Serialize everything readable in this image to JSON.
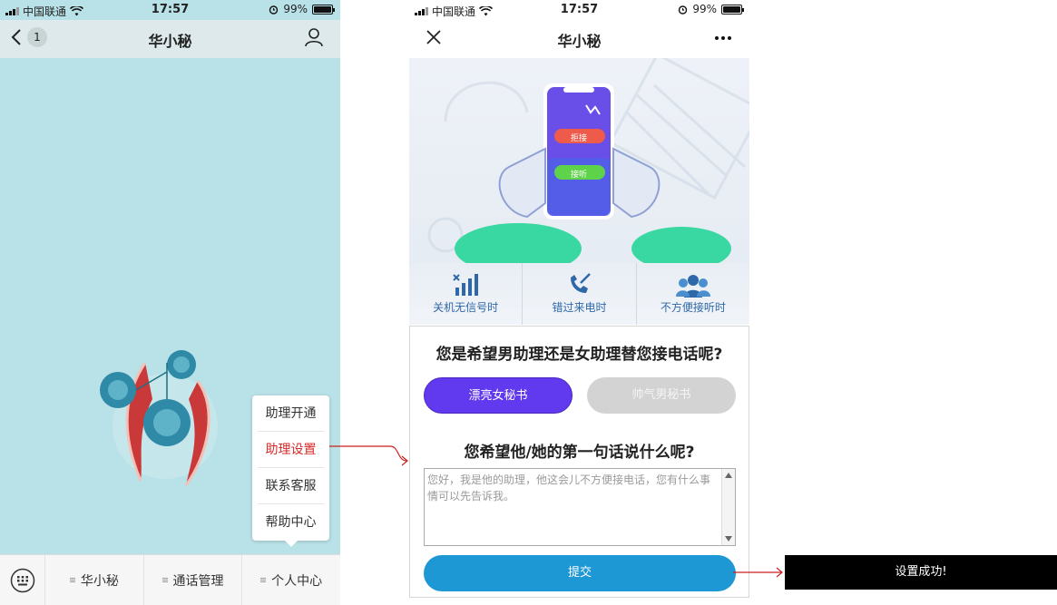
{
  "status_bar": {
    "carrier": "中国联通",
    "time": "17:57",
    "battery": "99%"
  },
  "left": {
    "nav": {
      "back_count": "1",
      "title": "华小秘"
    },
    "popup_menu": {
      "items": [
        "助理开通",
        "助理设置",
        "联系客服",
        "帮助中心"
      ],
      "active_index": 1
    },
    "bottom_tabs": [
      "华小秘",
      "通话管理",
      "个人中心"
    ]
  },
  "right": {
    "nav": {
      "title": "华小秘"
    },
    "banner": {
      "reject_label": "拒接",
      "answer_label": "接听"
    },
    "features": [
      "关机无信号时",
      "错过来电时",
      "不方便接听时"
    ],
    "question1": "您是希望男助理还是女助理替您接电话呢?",
    "options": {
      "female": "漂亮女秘书",
      "male": "帅气男秘书"
    },
    "question2": "您希望他/她的第一句话说什么呢?",
    "greeting_text": "您好，我是他的助理，他这会儿不方便接电话，您有什么事情可以先告诉我。",
    "submit_label": "提交"
  },
  "toast": {
    "message": "设置成功!"
  },
  "colors": {
    "accent_red": "#d62a2a",
    "female_purple": "#6139ee",
    "submit_blue": "#1d98d4",
    "bg_teal": "#b9e2e8"
  }
}
